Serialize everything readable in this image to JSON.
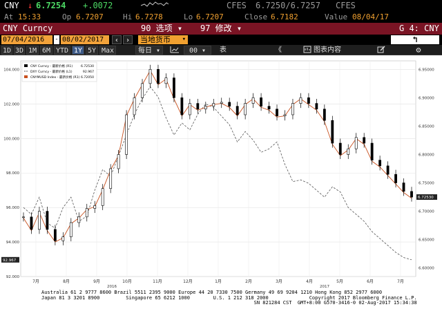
{
  "quote": {
    "ticker": "CNY",
    "direction_arrow": "↓",
    "last": "6.7254",
    "change": "+.0072",
    "source": "CFES",
    "bid_ask": "6.7250/6.7257",
    "source2": "CFES",
    "at_label": "At",
    "at_time": "15:33",
    "op_label": "Op",
    "op_value": "6.7207",
    "hi_label": "Hi",
    "hi_value": "6.7278",
    "lo_label": "Lo",
    "lo_value": "6.7207",
    "close_label": "Close",
    "close_value": "6.7182",
    "value_label": "Value",
    "value_date": "08/04/17"
  },
  "titlebar": {
    "security": "CNY Curncy",
    "menu1": "90 选项 ▾",
    "menu2": "97 修改 ▾",
    "page": "G 4: CNY"
  },
  "range": {
    "start": "07/04/2016",
    "sep": "-",
    "end": "08/02/2017",
    "currency": "当地货币",
    "back_icon": "↰"
  },
  "toolbar": {
    "periods": [
      "1D",
      "3D",
      "1M",
      "6M",
      "YTD",
      "1Y",
      "5Y",
      "Max"
    ],
    "active_period": "1Y",
    "freq": "每日 ▾",
    "chart_type": "00 ▾",
    "table": "表",
    "collapse": "《",
    "content": "图表内容",
    "edit_icon": "edit-icon",
    "gear_icon": "gear-icon"
  },
  "chart_data": {
    "type": "line",
    "legend": [
      {
        "name": "CNY Curncy - 最新价格 (R1)",
        "value": "6.72530",
        "color": "#000000",
        "style": "candle"
      },
      {
        "name": "DXY Curncy - 最新价格 (L1)",
        "value": "92.967",
        "color": "#555555",
        "style": "dashed"
      },
      {
        "name": "CNYMUSD Index - 最新价格 (R1)",
        "value": "6.72050",
        "color": "#c8501e",
        "style": "solid"
      }
    ],
    "left_axis": {
      "ylim": [
        92.0,
        104.5
      ],
      "ticks": [
        "104.000",
        "102.000",
        "100.000",
        "98.000",
        "96.000",
        "94.000",
        "92.000"
      ],
      "tick_values": [
        104,
        102,
        100,
        98,
        96,
        94,
        92
      ],
      "last_label": "92.967"
    },
    "right_axis": {
      "ylim": [
        6.585,
        6.965
      ],
      "ticks": [
        "6.95000",
        "6.90000",
        "6.85000",
        "6.80000",
        "6.75000",
        "6.70000",
        "6.65000",
        "6.60000"
      ],
      "tick_values": [
        6.95,
        6.9,
        6.85,
        6.8,
        6.75,
        6.7,
        6.65,
        6.6
      ],
      "last_label": "6.72530"
    },
    "x_ticks": [
      "7月",
      "8月",
      "9月",
      "10月",
      "11月",
      "12月",
      "1月",
      "2月",
      "3月",
      "4月",
      "5月",
      "6月",
      "7月"
    ],
    "year_labels": [
      {
        "label": "2016",
        "after_index": 2
      },
      {
        "label": "2017",
        "after_index": 9
      }
    ],
    "cny": [
      6.69,
      6.668,
      6.7,
      6.668,
      6.648,
      6.655,
      6.68,
      6.69,
      6.705,
      6.71,
      6.74,
      6.775,
      6.8,
      6.87,
      6.9,
      6.925,
      6.95,
      6.925,
      6.935,
      6.9,
      6.87,
      6.89,
      6.88,
      6.885,
      6.89,
      6.892,
      6.885,
      6.87,
      6.89,
      6.9,
      6.885,
      6.88,
      6.868,
      6.87,
      6.89,
      6.9,
      6.89,
      6.88,
      6.86,
      6.82,
      6.8,
      6.81,
      6.83,
      6.82,
      6.79,
      6.78,
      6.765,
      6.75,
      6.735,
      6.725
    ],
    "dxy": [
      96.0,
      95.6,
      96.6,
      95.1,
      94.8,
      96.0,
      96.6,
      95.2,
      95.5,
      97.0,
      98.2,
      97.8,
      99.0,
      100.2,
      101.4,
      102.3,
      103.0,
      102.4,
      101.2,
      100.2,
      100.9,
      100.5,
      101.4,
      102.0,
      101.8,
      101.3,
      100.8,
      99.8,
      100.4,
      99.9,
      99.2,
      99.4,
      99.8,
      98.5,
      97.5,
      97.6,
      97.4,
      97.0,
      96.6,
      97.2,
      96.9,
      96.0,
      95.6,
      95.2,
      94.6,
      94.2,
      93.8,
      93.4,
      93.1,
      92.97
    ]
  },
  "footer": {
    "line1": "Australia 61 2 9777 8600 Brazil 5511 2395 9000 Europe 44 20 7330 7500 Germany 49 69 9204 1210 Hong Kong 852 2977 6000",
    "line2": "Japan 81 3 3201 8900         Singapore 65 6212 1000        U.S. 1 212 318 2000              Copyright 2017 Bloomberg Finance L.P.",
    "line3": "                                                                         SN 821284 CST  GMT+8:00 G570-3416-0 02-Aug-2017 15:34:38"
  }
}
